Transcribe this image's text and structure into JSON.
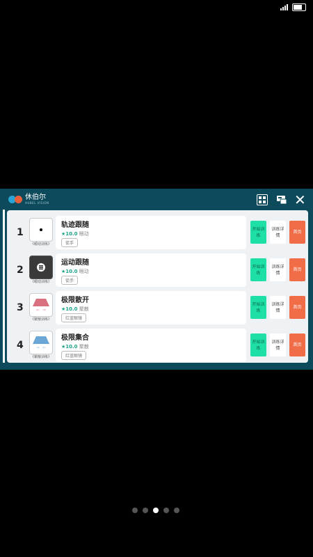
{
  "app": {
    "brand": "休伯尔",
    "brand_sub": "HUBEL VISION"
  },
  "items": [
    {
      "num": "1",
      "title": "轨迹跟随",
      "score": "★10.0",
      "category": "眼动",
      "tag": "徒手",
      "caption": "《眼动训练》",
      "thumb": "dot"
    },
    {
      "num": "2",
      "title": "运动跟随",
      "score": "★10.0",
      "category": "眼动",
      "tag": "徒手",
      "caption": "《眼动训练》",
      "thumb": "dark-disc"
    },
    {
      "num": "3",
      "title": "极限散开",
      "score": "★10.0",
      "category": "聚散",
      "tag": "红蓝眼镜",
      "caption": "《聚散训练》",
      "thumb": "red-trap"
    },
    {
      "num": "4",
      "title": "极限集合",
      "score": "★10.0",
      "category": "聚散",
      "tag": "红蓝眼镜",
      "caption": "《聚散训练》",
      "thumb": "blue-trap"
    }
  ],
  "buttons": {
    "start": "开始训练",
    "detail": "训练详情",
    "home": "首页"
  },
  "pager": {
    "count": 5,
    "active": 2
  }
}
